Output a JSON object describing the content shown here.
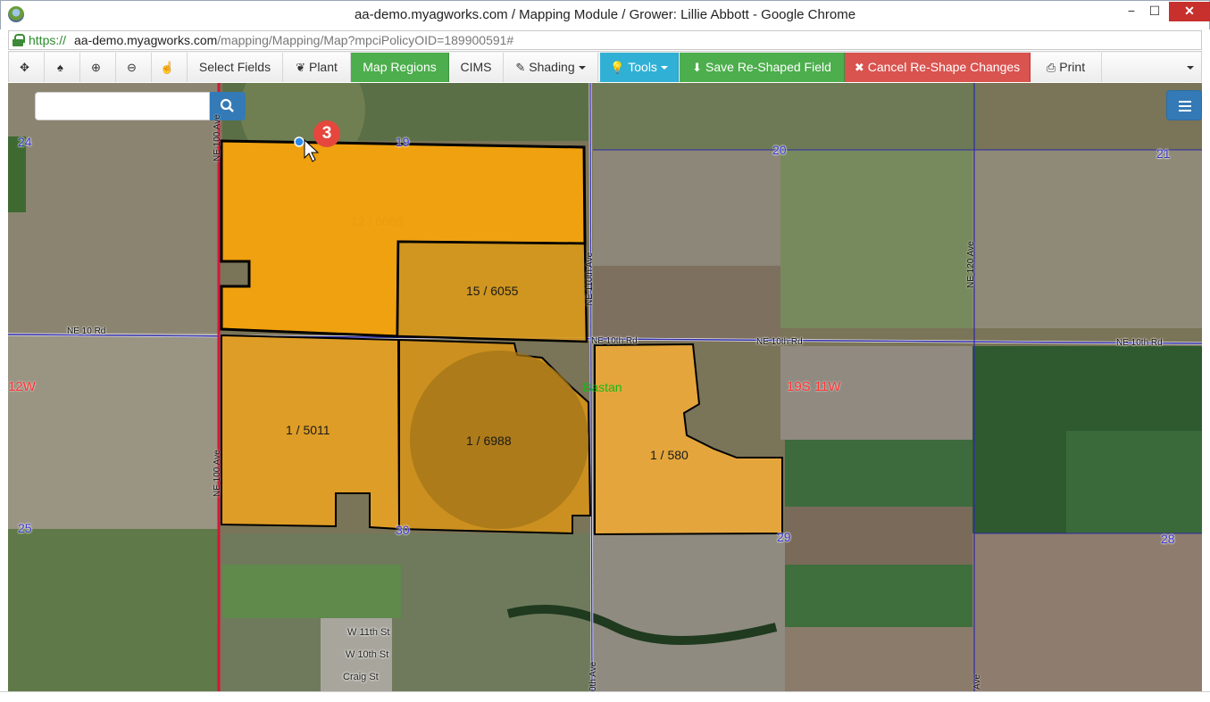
{
  "window": {
    "title": "aa-demo.myagworks.com / Mapping Module / Grower: Lillie Abbott - Google Chrome",
    "minimize": "−",
    "maximize": "☐",
    "close": "✕"
  },
  "address": {
    "scheme": "https://",
    "host": "aa-demo.myagworks.com",
    "path": "/mapping/Mapping/Map?mpciPolicyOID=189900591#"
  },
  "toolbar": {
    "pan_icon": "✥",
    "pin_icon": "♠",
    "zoom_in_icon": "⊕",
    "zoom_out_icon": "⊖",
    "hand_icon": "☝",
    "select_fields": "Select Fields",
    "plant_icon": "❦",
    "plant": "Plant",
    "map_regions": "Map Regions",
    "cims": "CIMS",
    "shading_icon": "✎",
    "shading": "Shading",
    "tools_icon": "💡",
    "tools": "Tools",
    "save_icon": "⬇",
    "save_reshaped": "Save Re-Shaped Field",
    "cancel_icon": "✖",
    "cancel_reshape": "Cancel Re-Shape Changes",
    "print_icon": "⎙",
    "print": "Print",
    "more_caret": "▾"
  },
  "map": {
    "search_placeholder": "",
    "search_icon": "search-icon",
    "step_badge": "3",
    "sections": {
      "s24": "24",
      "s19": "19",
      "s20": "20",
      "s21": "21",
      "s25": "25",
      "s30": "30",
      "s29": "29",
      "s28": "28"
    },
    "townships": {
      "west": "12W",
      "east": "19S 11W"
    },
    "town": "Bastan",
    "roads": {
      "ne10rd": "NE 10 Rd",
      "ne10th_a": "NE 10th Rd",
      "ne10th_b": "NE 10th Rd",
      "ne10th_c": "NE 10th Rd",
      "ne100_top": "NE 100 Ave",
      "ne100_bottom": "NE 100 Ave",
      "ne110": "NE 110th Ave",
      "ne120": "NE 120 Ave",
      "ave_bottom": "0th Ave",
      "ave_right": "Ave"
    },
    "streets": {
      "w11": "W 11th St",
      "w10": "W 10th St",
      "craig": "Craig St"
    },
    "fields": {
      "f12": "12 / 6065",
      "f15": "15 / 6055",
      "f1_5011": "1 / 5011",
      "f1_6988": "1 / 6988",
      "f1_580": "1 / 580"
    },
    "colors": {
      "field_fill": "#f5a30c",
      "section_line": "#2e2aa8",
      "county_line": "#d1173a"
    }
  }
}
